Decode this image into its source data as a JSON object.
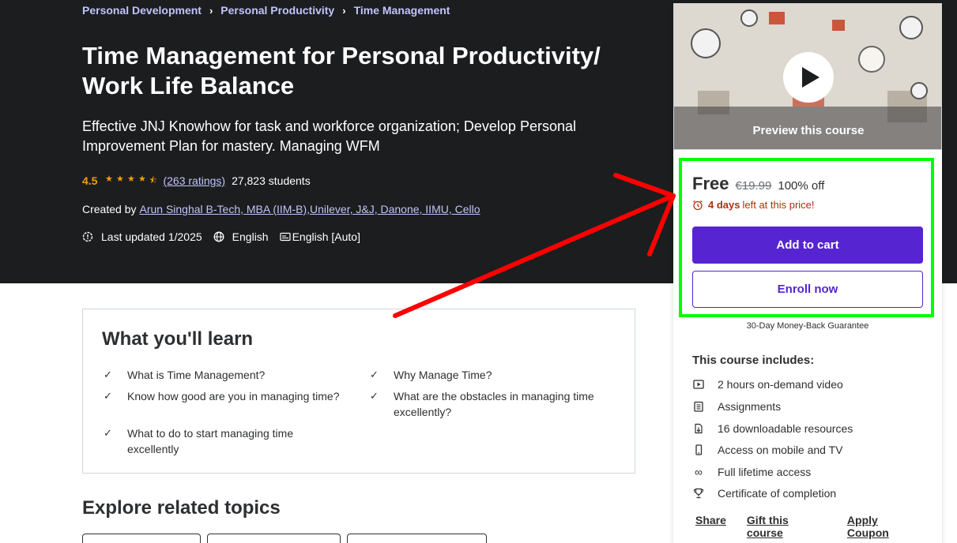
{
  "breadcrumb": [
    "Personal Development",
    "Personal Productivity",
    "Time Management"
  ],
  "course": {
    "title_line1": "Time Management for Personal Productivity/",
    "title_line2": "Work Life Balance",
    "subtitle": "Effective JNJ Knowhow for task and workforce organization; Develop Personal Improvement Plan for mastery. Managing WFM",
    "rating": "4.5",
    "rating_stars": 4.5,
    "ratings_count": "(263 ratings)",
    "students": "27,823 students",
    "created_by_label": "Created by",
    "instructor": "Arun Singhal B-Tech, MBA (IIM-B),Unilever, J&J, Danone, IIMU, Cello",
    "last_updated": "Last updated 1/2025",
    "language": "English",
    "captions": "English [Auto]"
  },
  "learn": {
    "heading": "What you'll learn",
    "items": [
      "What is Time Management?",
      "Why Manage Time?",
      "Know how good are you in managing time?",
      "What are the obstacles in managing time excellently?",
      "What to do to start managing time excellently"
    ]
  },
  "explore": {
    "heading": "Explore related topics"
  },
  "sidebar": {
    "preview_label": "Preview this course",
    "price": "Free",
    "original_price": "€19.99",
    "discount": "100% off",
    "timer_days": "4 days",
    "timer_rest": "left at this price!",
    "add_to_cart": "Add to cart",
    "enroll_now": "Enroll now",
    "guarantee": "30-Day Money-Back Guarantee",
    "includes_title": "This course includes:",
    "includes": [
      {
        "icon": "video-icon",
        "text": "2 hours on-demand video"
      },
      {
        "icon": "assignment-icon",
        "text": "Assignments"
      },
      {
        "icon": "download-icon",
        "text": "16 downloadable resources"
      },
      {
        "icon": "mobile-icon",
        "text": "Access on mobile and TV"
      },
      {
        "icon": "infinity-icon",
        "text": "Full lifetime access"
      },
      {
        "icon": "trophy-icon",
        "text": "Certificate of completion"
      }
    ],
    "links": [
      "Share",
      "Gift this course",
      "Apply Coupon"
    ]
  },
  "annotation": {
    "highlight_color": "#00ff00",
    "arrow_color": "#ff0000"
  },
  "colors": {
    "hero_bg": "#1c1d1f",
    "accent": "#5624d0",
    "link": "#c0c4fc",
    "star": "#f69c08",
    "urgent": "#b32d0f"
  }
}
